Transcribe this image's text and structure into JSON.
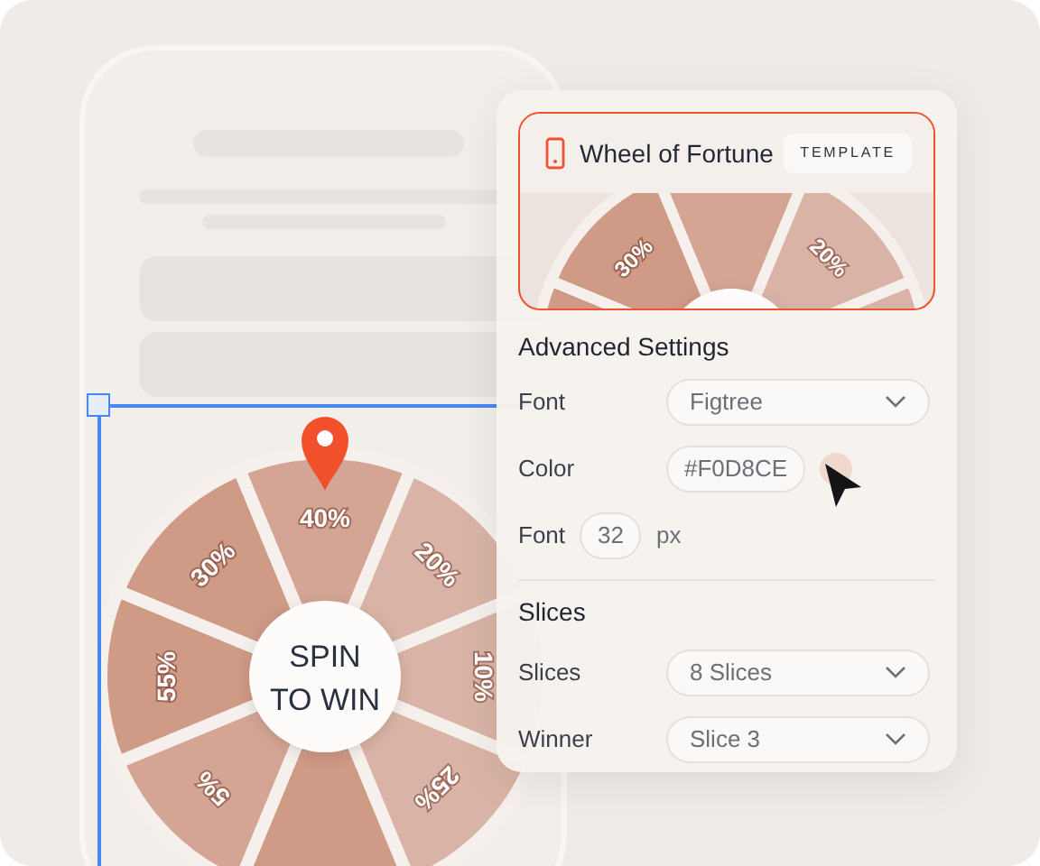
{
  "wheel": {
    "center_label": [
      "SPIN",
      "TO WIN"
    ],
    "slices": [
      {
        "label": "40%",
        "color": "#d4a594"
      },
      {
        "label": "20%",
        "color": "#d9b4a6"
      },
      {
        "label": "10%",
        "color": "#d9b4a6"
      },
      {
        "label": "25%",
        "color": "#d9b4a6"
      },
      {
        "color": "#cf9a86"
      },
      {
        "label": "5%",
        "color": "#d4a594"
      },
      {
        "label": "55%",
        "color": "#cf9a86"
      },
      {
        "label": "30%",
        "color": "#cf9a86"
      }
    ]
  },
  "panel": {
    "title": "Wheel of Fortune",
    "badge": "TEMPLATE",
    "preview_labels": [
      "30%",
      "20%"
    ],
    "sections": [
      {
        "heading": "Advanced Settings",
        "fields": [
          {
            "kind": "select",
            "label": "Font",
            "value": "Figtree"
          },
          {
            "kind": "color",
            "label": "Color",
            "value": "#F0D8CE"
          },
          {
            "kind": "number",
            "label": "Font",
            "value": "32",
            "unit": "px"
          }
        ]
      },
      {
        "heading": "Slices",
        "fields": [
          {
            "kind": "select",
            "label": "Slices",
            "value": "8 Slices"
          },
          {
            "kind": "select",
            "label": "Winner",
            "value": "Slice 3"
          }
        ]
      }
    ]
  }
}
